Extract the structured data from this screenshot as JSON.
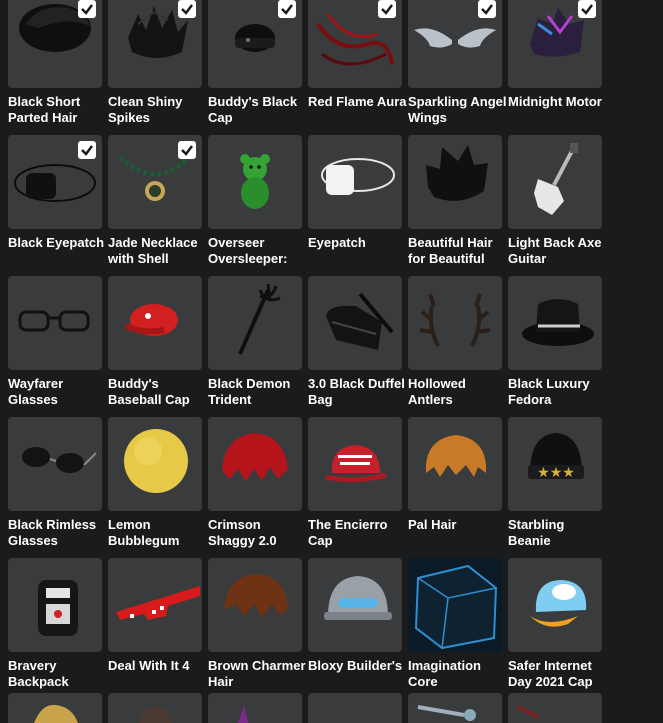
{
  "inventory": {
    "items": [
      {
        "name": "Black Short Parted Hair",
        "selected": true,
        "icon": "hair-icon"
      },
      {
        "name": "Clean Shiny Spikes",
        "selected": true,
        "icon": "hair-icon"
      },
      {
        "name": "Buddy's Black Cap",
        "selected": true,
        "icon": "cap-icon"
      },
      {
        "name": "Red Flame Aura",
        "selected": true,
        "icon": "aura-icon"
      },
      {
        "name": "Sparkling Angel Wings",
        "selected": true,
        "icon": "wings-icon"
      },
      {
        "name": "Midnight Motor",
        "selected": true,
        "icon": "hair-icon"
      },
      {
        "name": "Black Eyepatch",
        "selected": true,
        "icon": "eyepatch-icon"
      },
      {
        "name": "Jade Necklace with Shell",
        "selected": true,
        "icon": "necklace-icon"
      },
      {
        "name": "Overseer Oversleeper:",
        "selected": false,
        "icon": "teddy-bear-icon"
      },
      {
        "name": "Eyepatch",
        "selected": false,
        "icon": "eyepatch-icon"
      },
      {
        "name": "Beautiful Hair for Beautiful",
        "selected": false,
        "icon": "hair-icon"
      },
      {
        "name": "Light Back Axe Guitar",
        "selected": false,
        "icon": "guitar-icon"
      },
      {
        "name": "Wayfarer Glasses",
        "selected": false,
        "icon": "glasses-icon"
      },
      {
        "name": "Buddy's Baseball Cap",
        "selected": false,
        "icon": "cap-icon"
      },
      {
        "name": "Black Demon Trident",
        "selected": false,
        "icon": "trident-icon"
      },
      {
        "name": "3.0 Black Duffel Bag",
        "selected": false,
        "icon": "bag-icon"
      },
      {
        "name": "Hollowed Antlers",
        "selected": false,
        "icon": "antlers-icon"
      },
      {
        "name": "Black Luxury Fedora",
        "selected": false,
        "icon": "hat-icon"
      },
      {
        "name": "Black Rimless Glasses",
        "selected": false,
        "icon": "glasses-icon"
      },
      {
        "name": "Lemon Bubblegum",
        "selected": false,
        "icon": "bubblegum-icon"
      },
      {
        "name": "Crimson Shaggy 2.0",
        "selected": false,
        "icon": "hair-icon"
      },
      {
        "name": "The Encierro Cap",
        "selected": false,
        "icon": "cap-icon"
      },
      {
        "name": "Pal Hair",
        "selected": false,
        "icon": "hair-icon"
      },
      {
        "name": "Starbling Beanie",
        "selected": false,
        "icon": "beanie-icon"
      },
      {
        "name": "Bravery Backpack",
        "selected": false,
        "icon": "backpack-icon"
      },
      {
        "name": "Deal With It 4",
        "selected": false,
        "icon": "glasses-icon"
      },
      {
        "name": "Brown Charmer Hair",
        "selected": false,
        "icon": "hair-icon"
      },
      {
        "name": "Bloxy Builder's",
        "selected": false,
        "icon": "helmet-icon"
      },
      {
        "name": "Imagination Core",
        "selected": false,
        "icon": "cube-icon"
      },
      {
        "name": "Safer Internet Day 2021 Cap",
        "selected": false,
        "icon": "cap-icon"
      }
    ]
  },
  "colors": {
    "background": "#191b1d",
    "tile": "#393b3d",
    "text": "#ffffff",
    "check": "#ffffff"
  }
}
